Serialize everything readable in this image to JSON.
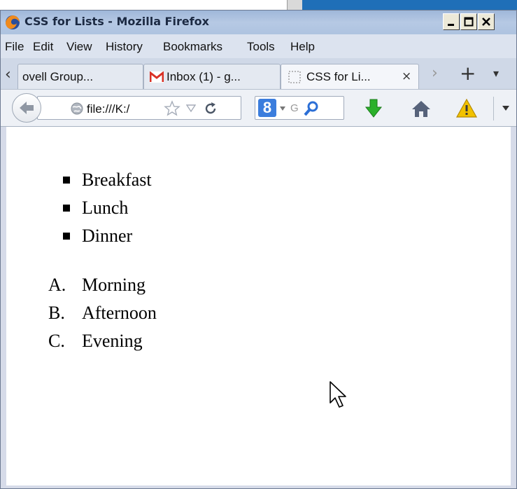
{
  "window": {
    "title": "CSS for Lists - Mozilla Firefox",
    "controls": [
      "minimize",
      "maximize",
      "close"
    ]
  },
  "menu": [
    "File",
    "Edit",
    "View",
    "History",
    "Bookmarks",
    "Tools",
    "Help"
  ],
  "tabs": [
    {
      "label": "ovell Group...",
      "icon": "page-icon"
    },
    {
      "label": "Inbox (1) - g...",
      "icon": "gmail-icon"
    },
    {
      "label": "CSS for Li...",
      "icon": "blank-page-icon",
      "active": true
    }
  ],
  "tab_controls": {
    "scroll_left": "‹",
    "scroll_right": "›",
    "new_tab": "+",
    "list_all": "▾"
  },
  "navbar": {
    "url": "file:///K:/",
    "search_engine": "8",
    "search_text": "G"
  },
  "content": {
    "unordered_list": [
      "Breakfast",
      "Lunch",
      "Dinner"
    ],
    "ordered_list": [
      {
        "marker": "A.",
        "text": "Morning"
      },
      {
        "marker": "B.",
        "text": "Afternoon"
      },
      {
        "marker": "C.",
        "text": "Evening"
      }
    ]
  },
  "colors": {
    "titlebar": "#aec3e0",
    "tab_active": "#f4f6fa",
    "gmail_red": "#d93025",
    "download_green": "#2bb02b",
    "warning_yellow": "#f2c200"
  }
}
